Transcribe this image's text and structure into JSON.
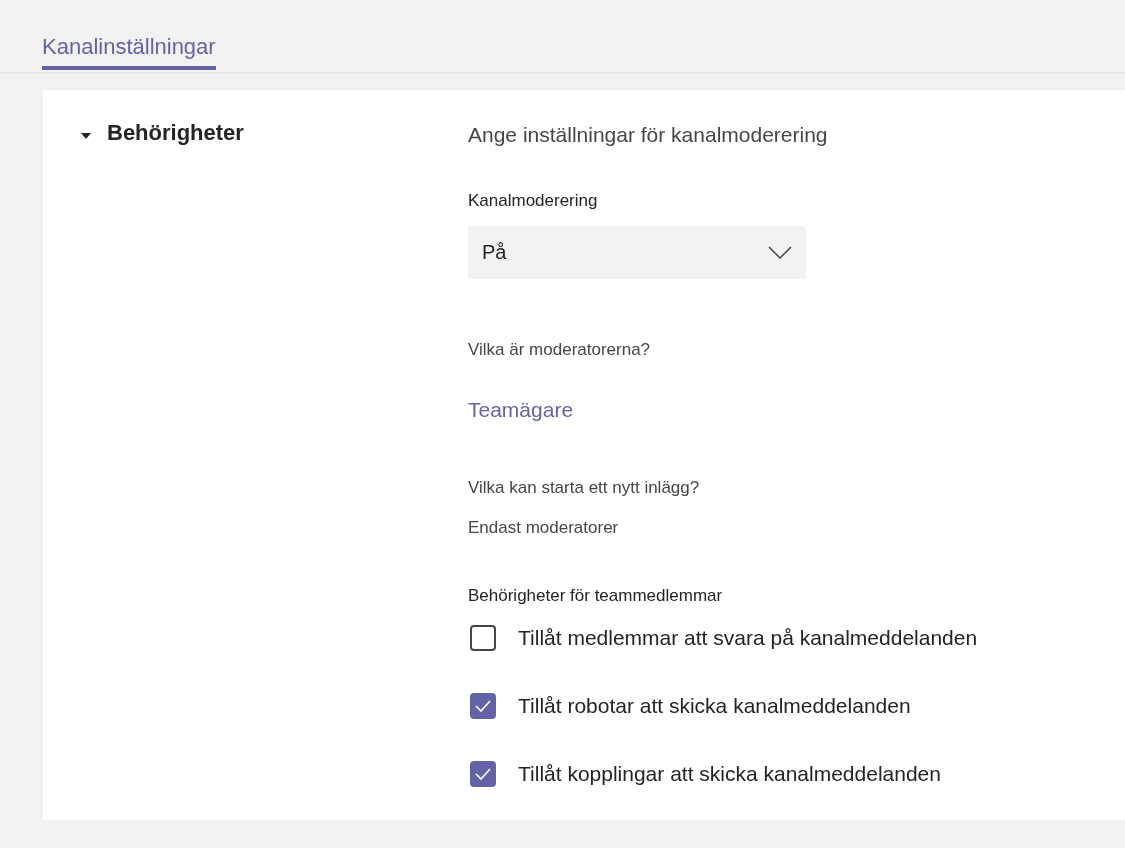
{
  "tabs": [
    {
      "label": "Kanalinställningar",
      "selected": true
    }
  ],
  "section": {
    "title": "Behörigheter",
    "expanded": true
  },
  "heading": "Ange inställningar för kanalmoderering",
  "moderation": {
    "label": "Kanalmoderering",
    "value": "På"
  },
  "moderators": {
    "question": "Vilka är moderatorerna?",
    "link": "Teamägare"
  },
  "new_post": {
    "question": "Vilka kan starta ett nytt inlägg?",
    "answer": "Endast moderatorer"
  },
  "member_permissions": {
    "label": "Behörigheter för teammedlemmar",
    "options": [
      {
        "label": "Tillåt medlemmar att svara på kanalmeddelanden",
        "checked": false
      },
      {
        "label": "Tillåt robotar att skicka kanalmeddelanden",
        "checked": true
      },
      {
        "label": "Tillåt kopplingar att skicka kanalmeddelanden",
        "checked": true
      }
    ]
  }
}
